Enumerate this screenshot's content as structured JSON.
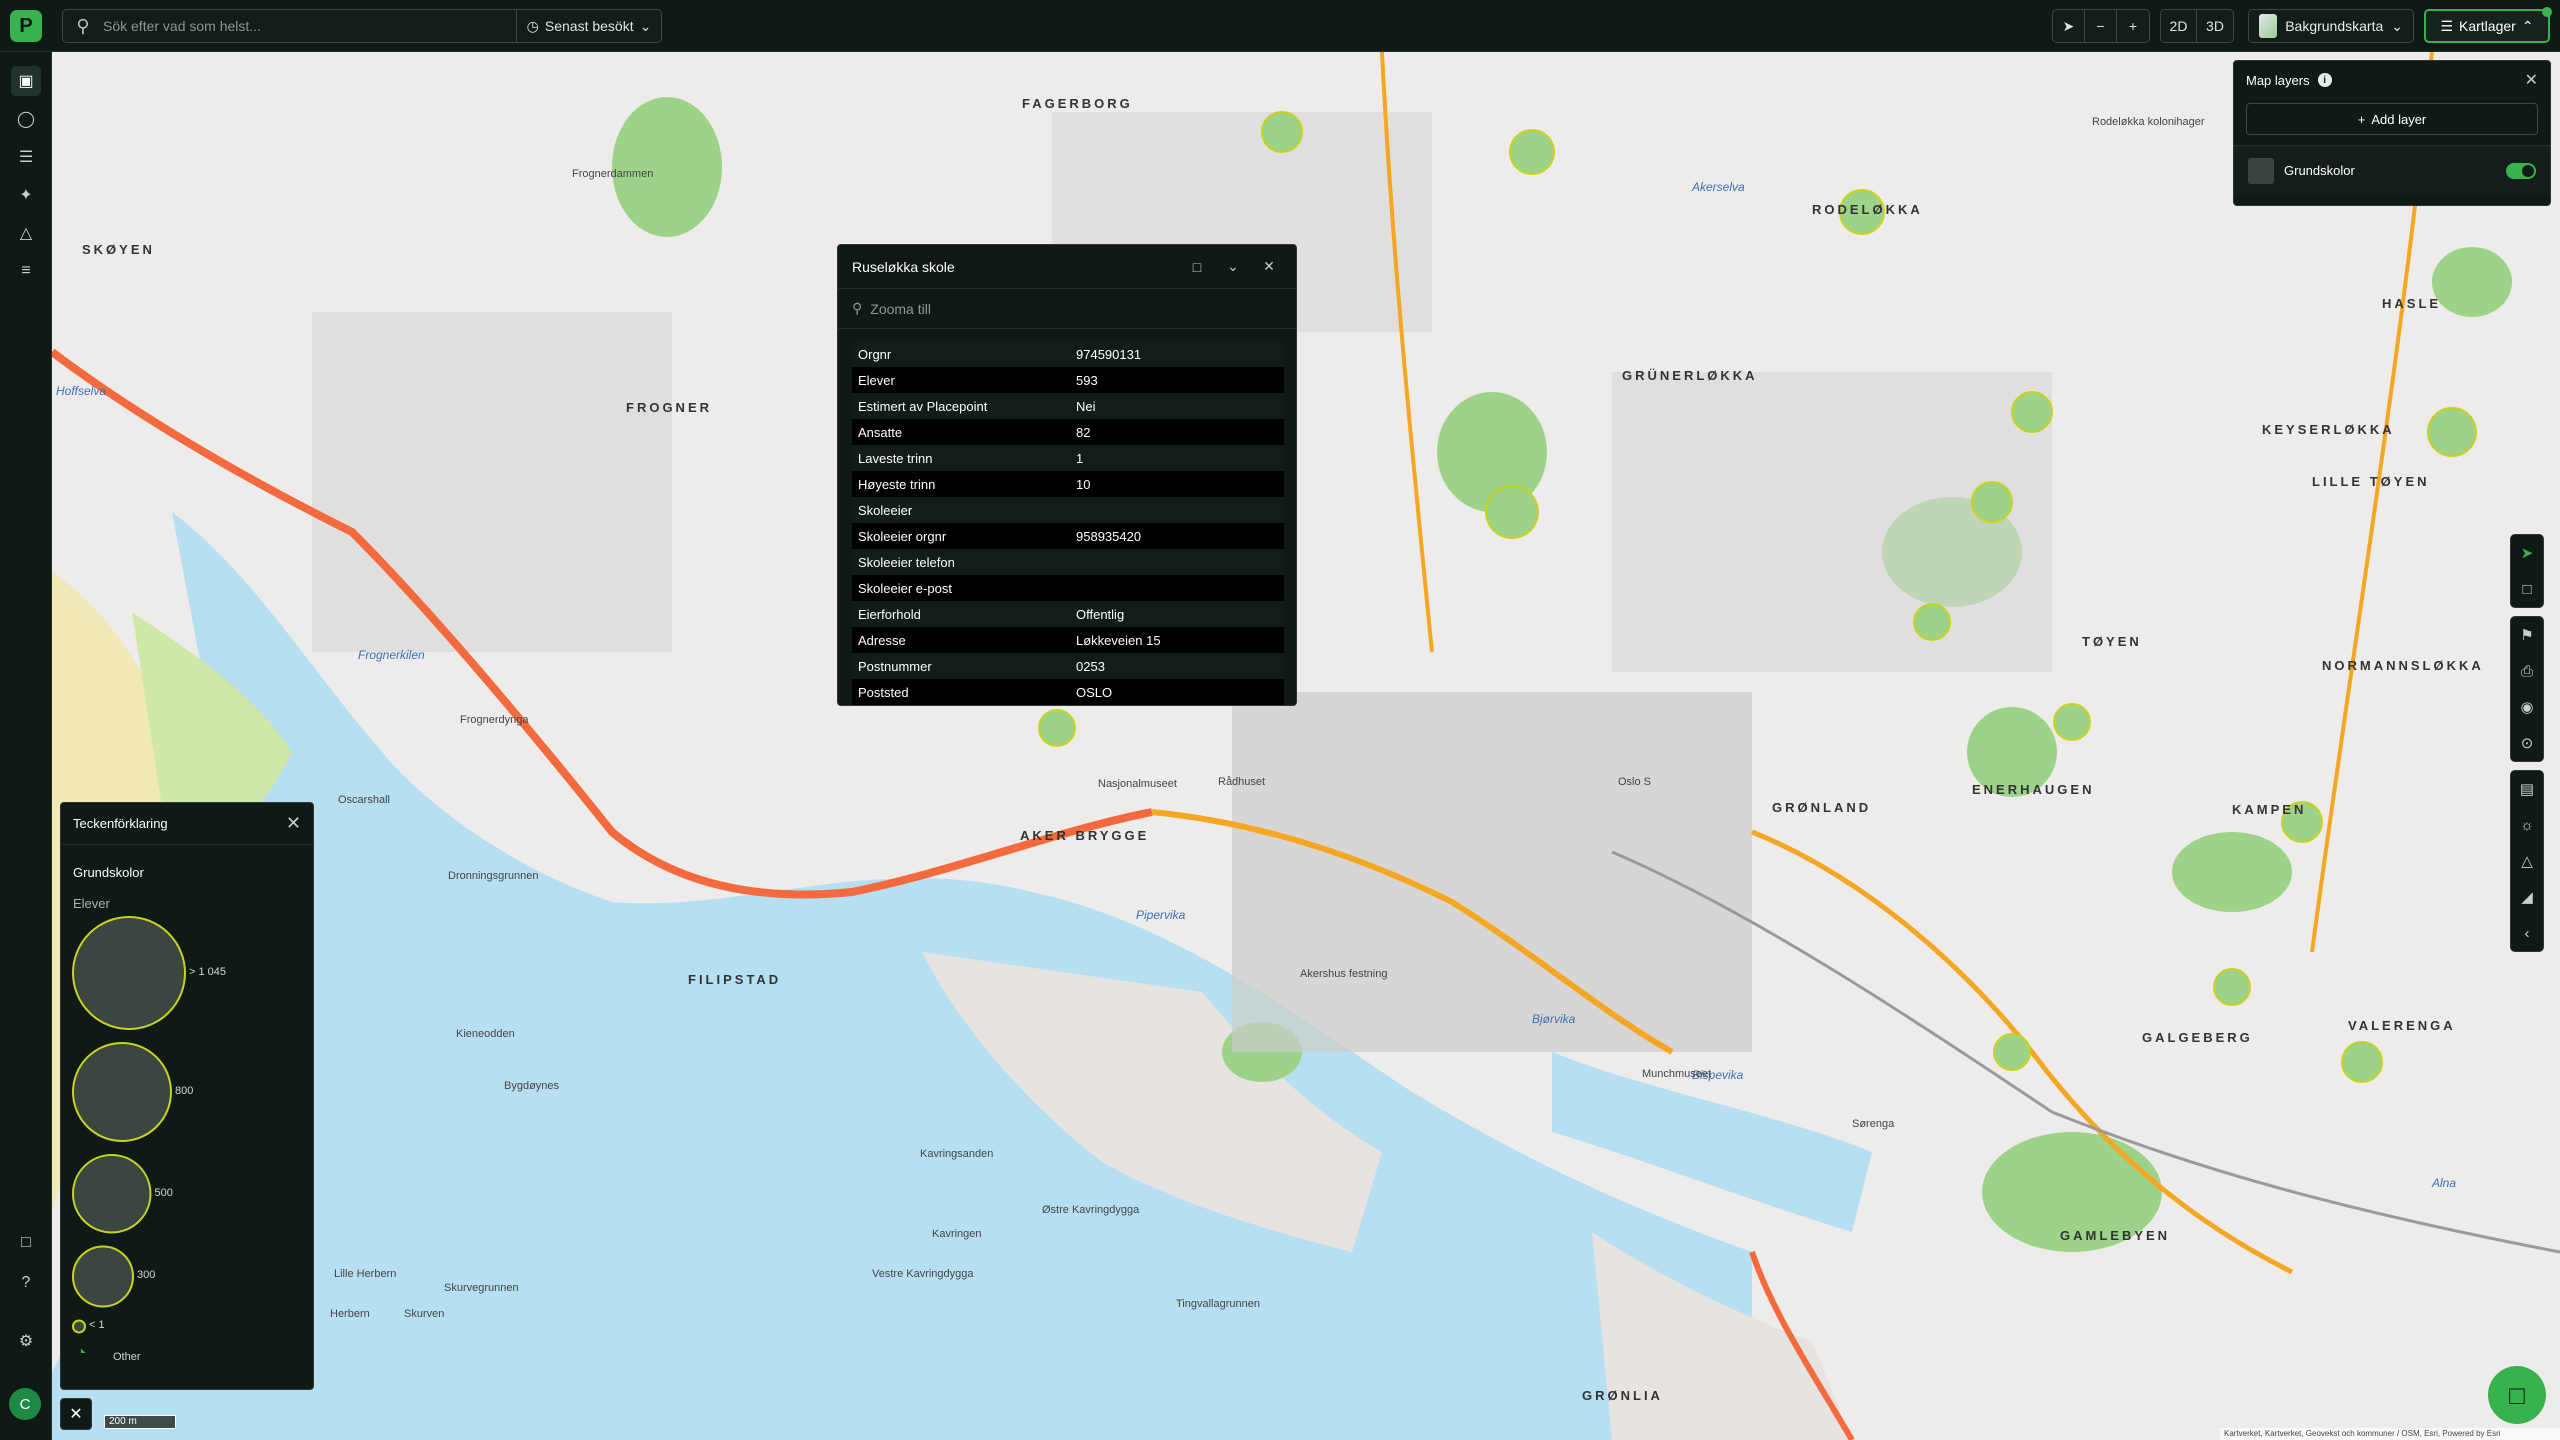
{
  "app": {
    "logo_letter": "P"
  },
  "search": {
    "placeholder": "Sök efter vad som helst...",
    "recent_label": "Senast besökt"
  },
  "toolbar": {
    "minus": "−",
    "plus": "+",
    "mode_2d": "2D",
    "mode_3d": "3D",
    "basemap_label": "Bakgrundskarta",
    "layers_label": "Kartlager"
  },
  "popup": {
    "title": "Ruseløkka skole",
    "zoom_label": "Zooma till",
    "rows": [
      {
        "key": "Orgnr",
        "value": "974590131"
      },
      {
        "key": "Elever",
        "value": "593"
      },
      {
        "key": "Estimert av Placepoint",
        "value": "Nei"
      },
      {
        "key": "Ansatte",
        "value": "82"
      },
      {
        "key": "Laveste trinn",
        "value": "1"
      },
      {
        "key": "Høyeste trinn",
        "value": "10"
      },
      {
        "key": "Skoleeier",
        "value": ""
      },
      {
        "key": "Skoleeier orgnr",
        "value": "958935420"
      },
      {
        "key": "Skoleeier telefon",
        "value": ""
      },
      {
        "key": "Skoleeier e-post",
        "value": ""
      },
      {
        "key": "Eierforhold",
        "value": "Offentlig"
      },
      {
        "key": "Adresse",
        "value": "Løkkeveien 15"
      },
      {
        "key": "Postnummer",
        "value": "0253"
      },
      {
        "key": "Poststed",
        "value": "OSLO"
      }
    ]
  },
  "layers_panel": {
    "title": "Map layers",
    "info": "i",
    "add_label": "Add layer",
    "layer_name": "Grundskolor",
    "layer_visible": true
  },
  "legend": {
    "title": "Teckenförklaring",
    "layer_name": "Grundskolor",
    "field_name": "Elever",
    "sizes": [
      {
        "label": "> 1 045",
        "value": 1045
      },
      {
        "label": "800",
        "value": 800
      },
      {
        "label": "500",
        "value": 500
      },
      {
        "label": "300",
        "value": 300
      },
      {
        "label": "< 1",
        "value": 1
      }
    ],
    "other_label": "Other",
    "symbol_fill": "#3b4641",
    "symbol_stroke": "#c9d21f"
  },
  "map": {
    "districts": [
      "FAGERBORG",
      "RODELØKKA",
      "SKØYEN",
      "HASLE",
      "GRÜNERLØKKA",
      "KEYSERLØKKA",
      "LILLE TØYEN",
      "FROGNER",
      "TØYEN",
      "NORMANNSLØKKA",
      "GRØNLAND",
      "ENERHAUGEN",
      "KAMPEN",
      "AKER BRYGGE",
      "FILIPSTAD",
      "GALGEBERG",
      "VALERENGA",
      "GAMLEBYEN",
      "GRØNLIA"
    ],
    "water_labels": [
      "Akerselva",
      "Frognerkilen",
      "Pipervika",
      "Bjørvika",
      "Bispevika",
      "Alna",
      "Hoffselva"
    ],
    "places": [
      "Rodeløkka kolonihager",
      "Frognerdammen",
      "Kavringsanden",
      "Østre Kavringdygga",
      "Kavringen",
      "Vestre Kavringdygga",
      "Tingvallagrunnen",
      "Lille Herbern",
      "Herbern",
      "Skurven",
      "Skurvegrunnen",
      "Bygdøynes",
      "Kieneodden",
      "Oscarshall",
      "Dronningsgrunnen",
      "Frognerdynga",
      "Sørenga",
      "Munchmuseet",
      "Rådhuset",
      "Nasjonalmuseet",
      "Akershus festning",
      "Oslo S"
    ],
    "scale_label": "200 m",
    "attribution": "Kartverket, Kartverket, Geovekst och kommuner / OSM, Esri, Powered by Esri"
  }
}
